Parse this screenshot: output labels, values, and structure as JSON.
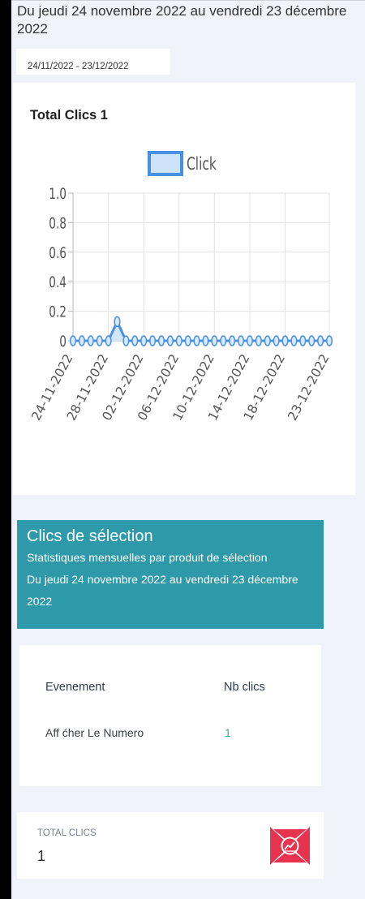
{
  "period_title": "Du jeudi 24 novembre 2022 au vendredi 23 décembre 2022",
  "date_range": "24/11/2022 - 23/12/2022",
  "chart_card": {
    "title_prefix": "Total Clics ",
    "title_value": "1"
  },
  "chart_data": {
    "type": "area",
    "legend": [
      "Click"
    ],
    "legend_position": "top",
    "series": [
      {
        "name": "Click",
        "values": [
          0,
          0,
          0,
          0,
          0,
          0.13,
          0,
          0,
          0,
          0,
          0,
          0,
          0,
          0,
          0,
          0,
          0,
          0,
          0,
          0,
          0,
          0,
          0,
          0,
          0,
          0,
          0,
          0,
          0,
          0
        ],
        "color": "#4a90e2",
        "fill": "#cce3f8"
      }
    ],
    "x": [
      "24-11-2022",
      "25-11-2022",
      "26-11-2022",
      "27-11-2022",
      "28-11-2022",
      "29-11-2022",
      "30-11-2022",
      "01-12-2022",
      "02-12-2022",
      "03-12-2022",
      "04-12-2022",
      "05-12-2022",
      "06-12-2022",
      "07-12-2022",
      "08-12-2022",
      "09-12-2022",
      "10-12-2022",
      "11-12-2022",
      "12-12-2022",
      "13-12-2022",
      "14-12-2022",
      "15-12-2022",
      "16-12-2022",
      "17-12-2022",
      "18-12-2022",
      "19-12-2022",
      "20-12-2022",
      "21-12-2022",
      "22-12-2022",
      "23-12-2022"
    ],
    "x_tick_labels": [
      "24-11-2022",
      "28-11-2022",
      "02-12-2022",
      "06-12-2022",
      "10-12-2022",
      "14-12-2022",
      "18-12-2022",
      "23-12-2022"
    ],
    "y_ticks": [
      "1.0",
      "0.8",
      "0.6",
      "0.4",
      "0.2",
      "0"
    ],
    "ylim": [
      0,
      1
    ],
    "grid": true
  },
  "selection": {
    "title": "Clics de sélection",
    "subtitle": "Statistiques mensuelles par produit de sélection",
    "period": "Du jeudi 24 novembre 2022 au vendredi 23 décembre 2022"
  },
  "table": {
    "headers": [
      "Evenement",
      "Nb clics"
    ],
    "rows": [
      {
        "event": "Aff ćher Le Numero",
        "clicks": "1"
      }
    ]
  },
  "total": {
    "label": "TOTAL CLICS",
    "value": "1",
    "icon": "chart-stats-icon",
    "icon_color": "#e8334f"
  },
  "colors": {
    "accent": "#2e9aa9",
    "positive": "#34b38a",
    "background": "#f0f3f9"
  }
}
